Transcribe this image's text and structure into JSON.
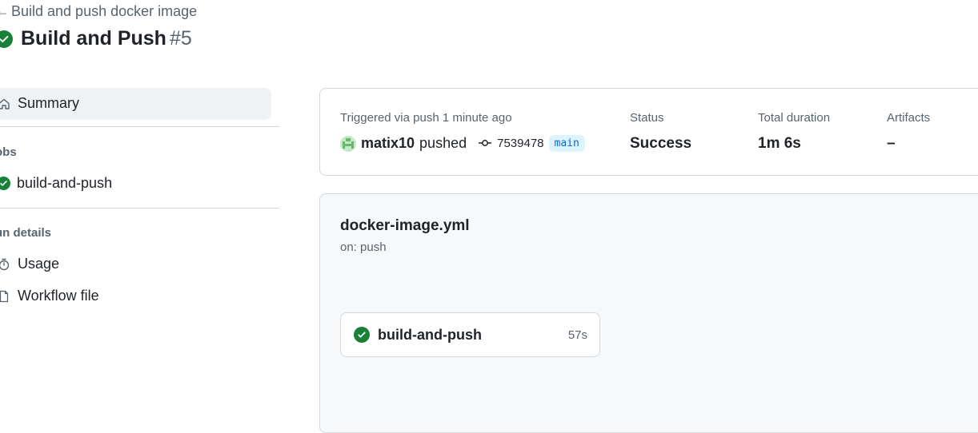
{
  "header": {
    "back_link": "Build and push docker image",
    "title": "Build and Push",
    "run_number": "#5"
  },
  "sidebar": {
    "summary_label": "Summary",
    "jobs_heading": "obs",
    "jobs": [
      {
        "label": "build-and-push",
        "status": "success"
      }
    ],
    "run_details_heading": "un details",
    "run_details_items": [
      {
        "label": "Usage",
        "icon": "stopwatch-icon"
      },
      {
        "label": "Workflow file",
        "icon": "file-icon"
      }
    ]
  },
  "summary": {
    "triggered": "Triggered via push 1 minute ago",
    "actor": "matix10",
    "action": "pushed",
    "commit": "7539478",
    "branch": "main",
    "status_label": "Status",
    "status_value": "Success",
    "duration_label": "Total duration",
    "duration_value": "1m 6s",
    "artifacts_label": "Artifacts",
    "artifacts_value": "–"
  },
  "workflow": {
    "file": "docker-image.yml",
    "trigger": "on: push",
    "job": {
      "name": "build-and-push",
      "duration": "57s"
    }
  },
  "colors": {
    "success": "#1a7f37",
    "accent": "#0969da",
    "muted": "#59636e",
    "border": "#d1d9e0"
  }
}
